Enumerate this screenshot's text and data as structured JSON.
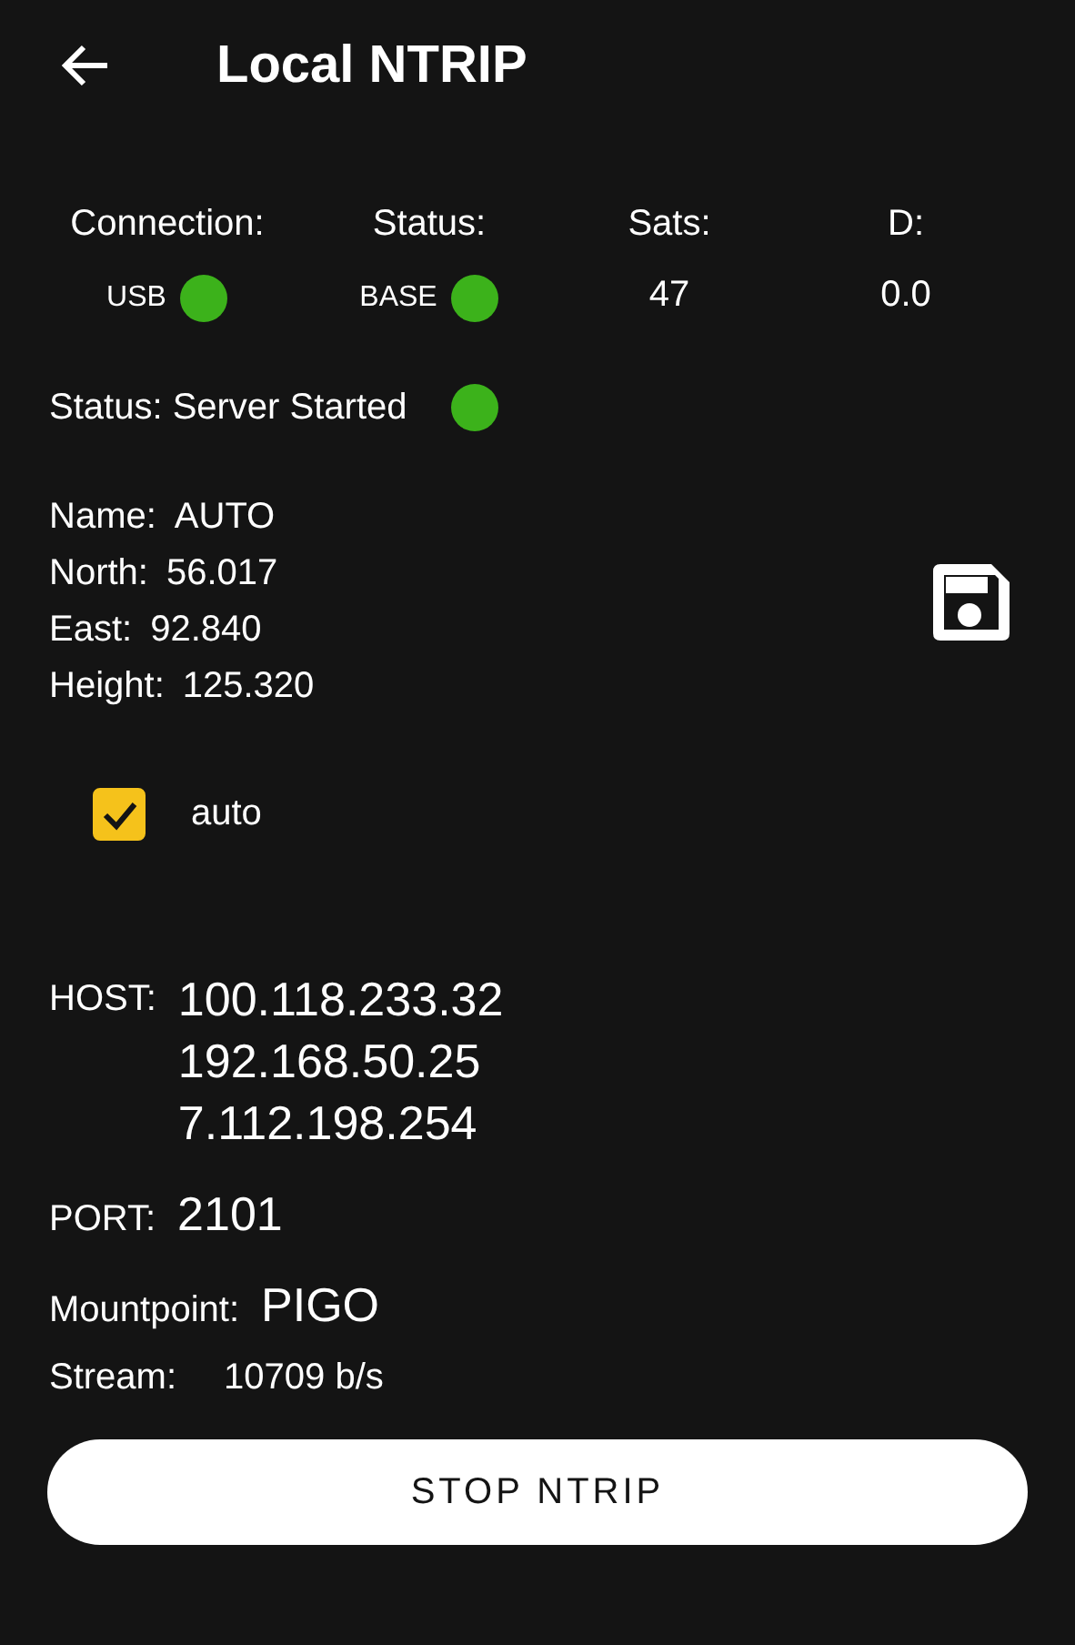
{
  "header": {
    "title": "Local NTRIP"
  },
  "summary": [
    {
      "label": "Connection:",
      "kind": "indicator",
      "value": "USB",
      "color": "#3cb21b"
    },
    {
      "label": "Status:",
      "kind": "indicator",
      "value": "BASE",
      "color": "#3cb21b"
    },
    {
      "label": "Sats:",
      "kind": "number",
      "value": "47"
    },
    {
      "label": "D:",
      "kind": "number",
      "value": "0.0"
    }
  ],
  "server_status": {
    "text": "Status: Server Started",
    "color": "#3cb21b"
  },
  "base": [
    {
      "label": "Name:",
      "value": "AUTO"
    },
    {
      "label": "North:",
      "value": "56.017"
    },
    {
      "label": "East:",
      "value": "92.840"
    },
    {
      "label": "Height:",
      "value": "125.320"
    }
  ],
  "auto_checkbox": {
    "label": "auto",
    "checked": true
  },
  "host": {
    "label": "HOST:",
    "values": [
      "100.118.233.32",
      "192.168.50.25",
      "7.112.198.254"
    ]
  },
  "port": {
    "label": "PORT:",
    "value": "2101"
  },
  "mountpoint": {
    "label": "Mountpoint:",
    "value": "PIGO"
  },
  "stream": {
    "label": "Stream:",
    "value": "10709 b/s"
  },
  "button": {
    "label": "STOP NTRIP"
  }
}
